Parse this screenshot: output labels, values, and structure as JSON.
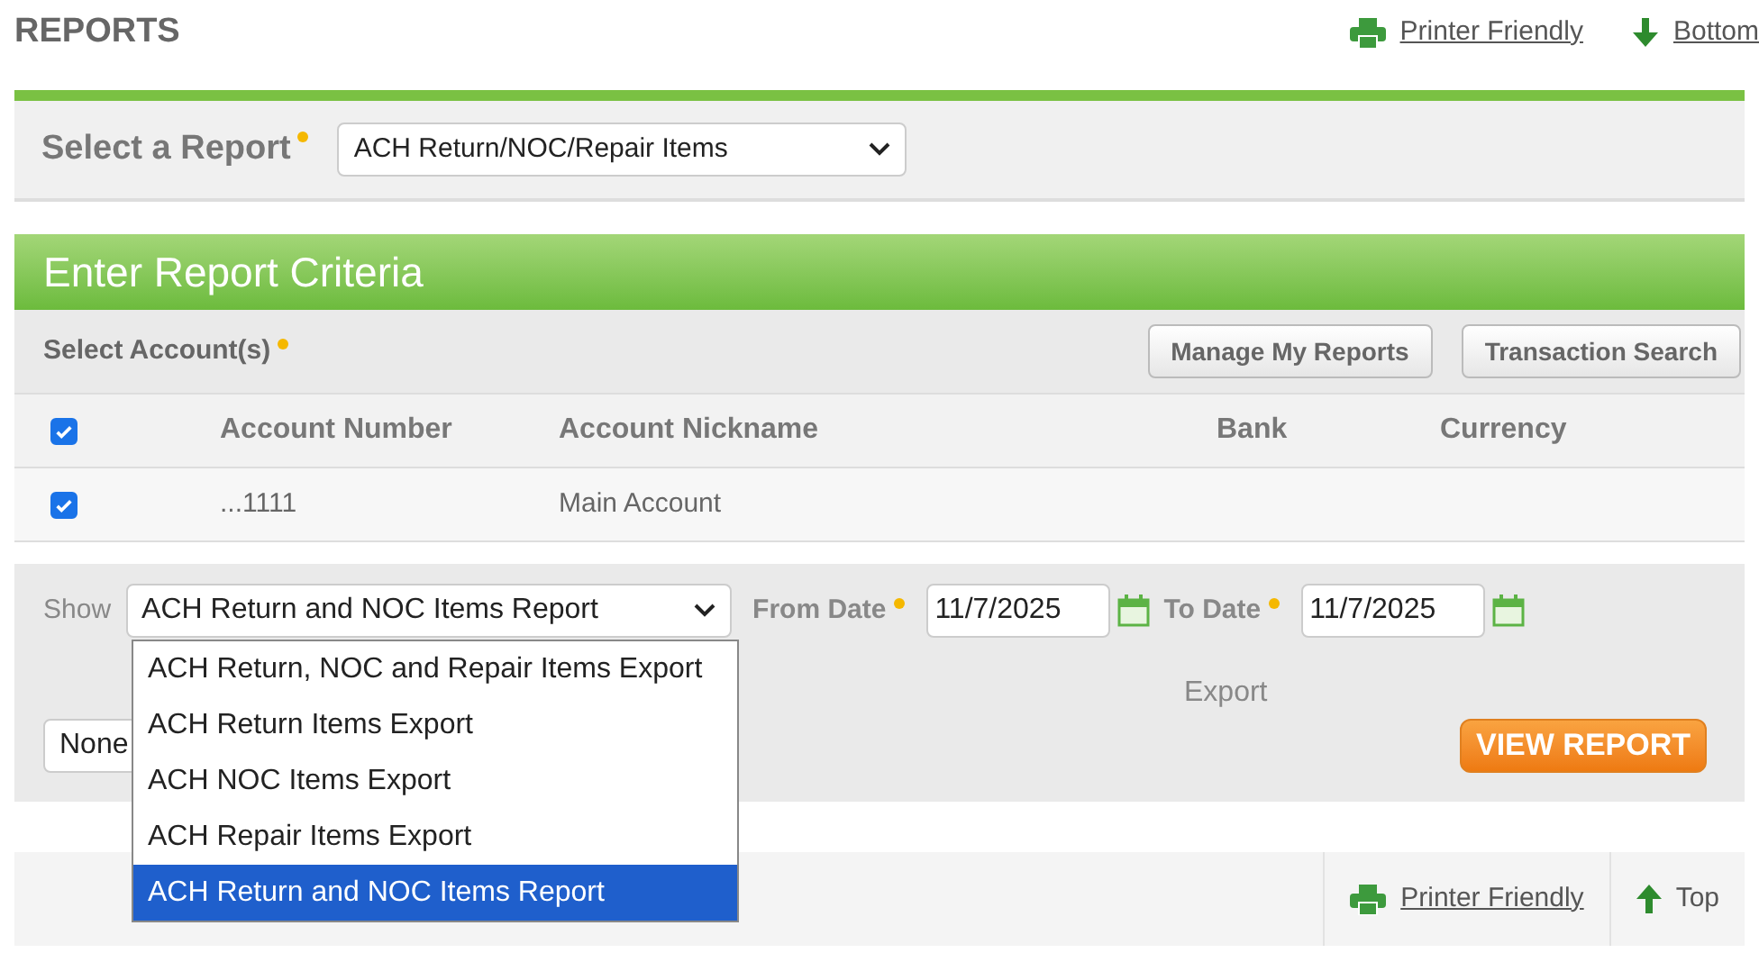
{
  "page_title": "REPORTS",
  "top_links": [
    {
      "kind": "print",
      "label": "Printer Friendly"
    },
    {
      "kind": "down",
      "label": "Bottom"
    }
  ],
  "report_select": {
    "label": "Select a Report",
    "value": "ACH Return/NOC/Repair Items"
  },
  "criteria": {
    "title": "Enter Report Criteria",
    "accounts_label": "Select Account(s)",
    "buttons": [
      "Manage My Reports",
      "Transaction Search"
    ],
    "header": {
      "checked": true,
      "columns": [
        "Account Number",
        "Account Nickname",
        "Bank",
        "Currency"
      ]
    },
    "rows": [
      {
        "checked": true,
        "cells": [
          "...1111",
          "Main Account",
          "",
          ""
        ]
      }
    ],
    "show_label": "Show",
    "show_value": "ACH Return and NOC Items Report",
    "from_label": "From Date",
    "from_value": "11/7/2025",
    "to_label": "To Date",
    "to_value": "11/7/2025",
    "export_label": "Export",
    "export_value": "None",
    "view_button": "VIEW REPORT",
    "options": [
      {
        "label": "ACH Return, NOC and Repair Items Export",
        "selected": false
      },
      {
        "label": "ACH Return Items Export",
        "selected": false
      },
      {
        "label": "ACH NOC Items Export",
        "selected": false
      },
      {
        "label": "ACH Repair Items Export",
        "selected": false
      },
      {
        "label": "ACH Return and NOC Items Report",
        "selected": true
      }
    ]
  },
  "bottom_links": [
    {
      "kind": "print",
      "label": "Printer Friendly"
    },
    {
      "kind": "up",
      "label": "Top"
    }
  ]
}
